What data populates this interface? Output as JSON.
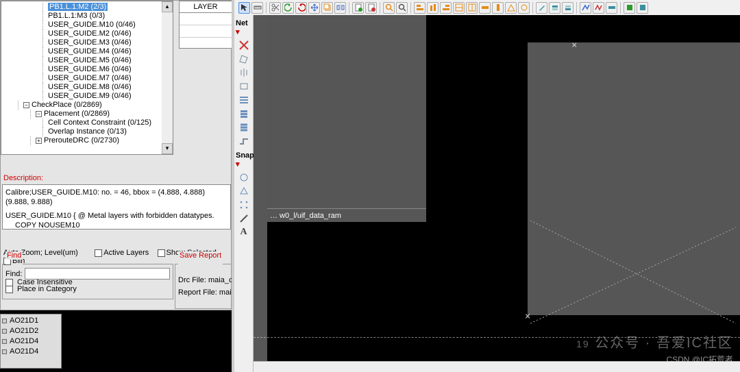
{
  "tree": {
    "items": [
      {
        "label": "PB1.L.1:M2 (2/3)",
        "indent": 3,
        "sel": true
      },
      {
        "label": "PB1.L.1:M3 (0/3)",
        "indent": 3
      },
      {
        "label": "USER_GUIDE.M10 (0/46)",
        "indent": 3
      },
      {
        "label": "USER_GUIDE.M2 (0/46)",
        "indent": 3
      },
      {
        "label": "USER_GUIDE.M3 (0/46)",
        "indent": 3
      },
      {
        "label": "USER_GUIDE.M4 (0/46)",
        "indent": 3
      },
      {
        "label": "USER_GUIDE.M5 (0/46)",
        "indent": 3
      },
      {
        "label": "USER_GUIDE.M6 (0/46)",
        "indent": 3
      },
      {
        "label": "USER_GUIDE.M7 (0/46)",
        "indent": 3
      },
      {
        "label": "USER_GUIDE.M8 (0/46)",
        "indent": 3
      },
      {
        "label": "USER_GUIDE.M9 (0/46)",
        "indent": 3
      },
      {
        "label": "CheckPlace (0/2869)",
        "indent": 1,
        "expander": "-"
      },
      {
        "label": "Placement (0/2869)",
        "indent": 2,
        "expander": "-"
      },
      {
        "label": "Cell Context Constraint (0/125)",
        "indent": 3
      },
      {
        "label": "Overlap Instance (0/13)",
        "indent": 3
      },
      {
        "label": "PrerouteDRC (0/2730)",
        "indent": 2,
        "expander": "+"
      }
    ]
  },
  "layer_panel": {
    "header": "LAYER"
  },
  "description": {
    "title": "Description:",
    "line1": "Calibre;USER_GUIDE.M10: no. = 46, bbox = (4.888, 4.888) (9.888, 9.888)",
    "line2": "USER_GUIDE.M10 { @ Metal layers with forbidden datatypes.",
    "line3": "COPY NOUSEM10"
  },
  "options": {
    "auto_zoom": "Auto Zoom;  Level(um)",
    "active_layers": "Active Layers",
    "show_selected": "Show Selected",
    "blink": "Blin"
  },
  "find": {
    "title": "Find",
    "label": "Find:",
    "case": "Case Insensitive",
    "place": "Place in Category"
  },
  "save": {
    "title": "Save Report",
    "drc": "Drc File:",
    "drc_val": "maia_c",
    "rpt": "Report File:",
    "rpt_val": "maia_c"
  },
  "cells": {
    "items": [
      "AO21D1",
      "AO21D2",
      "AO21D4",
      "AO21D4"
    ]
  },
  "palettes": {
    "net": "Net",
    "snap": "Snap",
    "a_glyph": "A"
  },
  "canvas": {
    "region1_label": "… w0_l/uif_data_ram"
  },
  "watermark": {
    "big": "公众号 · 吾爱IC社区",
    "small": "CSDN @IC拓荒者",
    "num": "19"
  },
  "icons": {
    "top": [
      "select-cursor",
      "ruler",
      "scissors",
      "undo",
      "redo",
      "move",
      "copy",
      "mirror",
      "sheet-green",
      "sheet-red",
      "zoom",
      "magnifier",
      "align-left",
      "align-down",
      "align-right",
      "orange1",
      "orange2",
      "orange3",
      "orange4",
      "orange5",
      "orange6",
      "pencil",
      "layer-up",
      "layer-down",
      "path",
      "zigzag",
      "ruler2",
      "green-box",
      "teal-box"
    ],
    "left": [
      "cross",
      "poly",
      "split-v",
      "rect",
      "bars",
      "stack",
      "bars2",
      "offset",
      "circle",
      "slash",
      "t-up"
    ]
  },
  "colors": {
    "toolbar_grey": "#f0f0f0",
    "canvas_bg": "#565656",
    "accent_blue": "#4a90d9",
    "red": "#c00",
    "green": "#2a9d2a",
    "orange": "#e28b1a",
    "teal": "#3a8fa0"
  }
}
